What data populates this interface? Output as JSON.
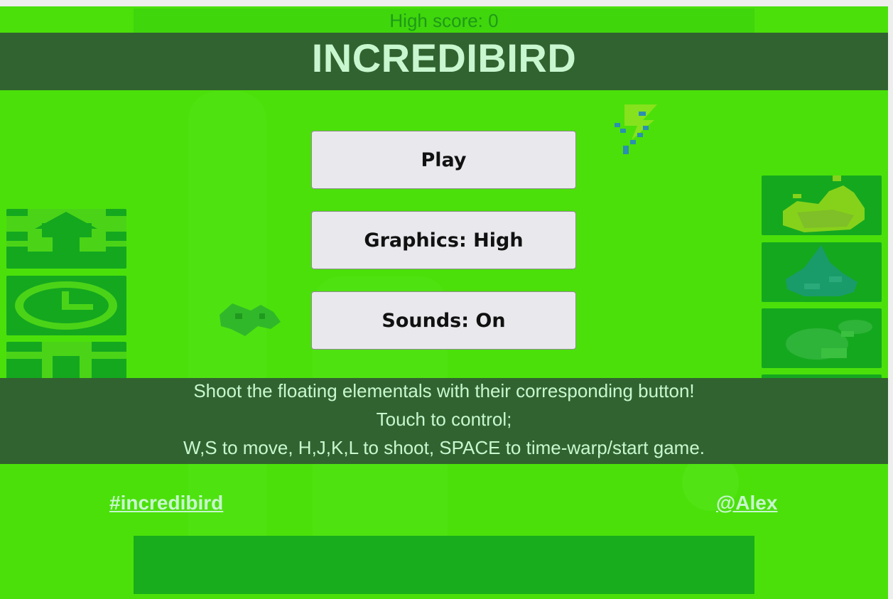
{
  "high_score": {
    "label": "High score: 0"
  },
  "title": "INCREDIBIRD",
  "menu": {
    "play_label": "Play",
    "graphics_label": "Graphics: High",
    "sounds_label": "Sounds: On"
  },
  "instructions": [
    "Shoot the floating elementals with their corresponding button!",
    "Touch to control;",
    "W,S to move, H,J,K,L to shoot, SPACE to time-warp/start game."
  ],
  "footer": {
    "hashtag_link": "#incredibird",
    "author_link": "@Alex"
  },
  "colors": {
    "background": "#4be00a",
    "band": "#316330",
    "band_text": "#c8f7cf",
    "button_bg": "#e9e8ed"
  },
  "icons": {
    "left_tiles": [
      "up-arrow-icon",
      "clock-icon",
      "down-arrow-icon"
    ],
    "right_tiles": [
      "fire-element-icon",
      "water-element-icon",
      "earth-element-icon"
    ],
    "floating": [
      "lightning-elemental-icon",
      "bird-icon"
    ]
  }
}
